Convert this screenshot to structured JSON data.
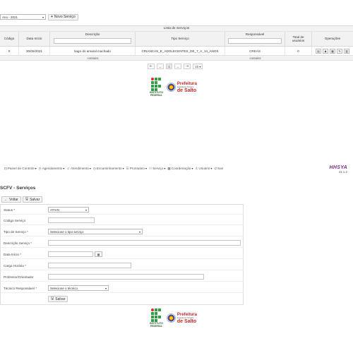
{
  "top": {
    "year_select": "Ano - 2021",
    "new_service_button": "Novo Serviço"
  },
  "list": {
    "title": "Lista de Serviços",
    "headers": [
      "Código",
      "Data Início",
      "Descrição",
      "Tipo Serviço",
      "Responsável",
      "Total de usuários",
      "Operações"
    ],
    "row": [
      "0",
      "30/05/2021",
      "tiago do amaral machado",
      "CRIANCAS_E_ADOLECENTES_DE_7_A_14_ANOS",
      "CREAS",
      "0"
    ],
    "footer": {
      "c3": "contains",
      "c5": "contains"
    },
    "operations_icons": [
      "print-icon",
      "users-icon",
      "calendar-icon",
      "edit-icon",
      "trash-icon"
    ]
  },
  "pager": {
    "first": "⇤",
    "prev": "←",
    "page": "1",
    "next": "→",
    "last": "⇥",
    "page_size": "15"
  },
  "logos": {
    "institute_line1": "INSTITUTO",
    "institute_line2": "FEDERAL",
    "prefeitura": "Prefeitura",
    "prefeitura_sub": "da Estância Turística",
    "city": "de Salto"
  },
  "nav": {
    "items": [
      {
        "label": "Painel de Controle",
        "icon": "dashboard-icon",
        "caret": true
      },
      {
        "label": "Agendamento",
        "icon": "clock-icon",
        "caret": true
      },
      {
        "label": "Atendimento",
        "icon": "smile-icon",
        "caret": true
      },
      {
        "label": "Encaminhamento",
        "icon": "clock-icon",
        "caret": true
      },
      {
        "label": "Prontuário",
        "icon": "list-icon",
        "caret": true
      },
      {
        "label": "Serviço",
        "icon": "people-icon",
        "caret": true
      },
      {
        "label": "Coordenação",
        "icon": "grid-icon",
        "caret": true
      },
      {
        "label": "Usuário",
        "icon": "user-icon",
        "caret": true
      },
      {
        "label": "Sair",
        "icon": "power-icon",
        "caret": false
      }
    ],
    "brand": "HHSYA",
    "version": "v3.1.2"
  },
  "form": {
    "page_title": "SCFV - Serviços",
    "back_button": "Voltar",
    "save_button_top": "Salvar",
    "status_label": "Status *",
    "status_value": "ATIVO",
    "codigo_label": "Código Serviço",
    "codigo_value": "",
    "tipo_label": "Tipo de Serviço *",
    "tipo_value": "Selecione o tipo serviço",
    "descricao_label": "Descrição Serviço *",
    "descricao_value": "",
    "data_label": "Data Início *",
    "data_value": "",
    "carga_label": "Carga Horária *",
    "carga_value": "",
    "professor_label": "Professor/Orientador",
    "professor_value": "",
    "tecnico_label": "Técnico Responsável *",
    "tecnico_value": "Selecione o técnico",
    "save_button": "Salvar"
  }
}
